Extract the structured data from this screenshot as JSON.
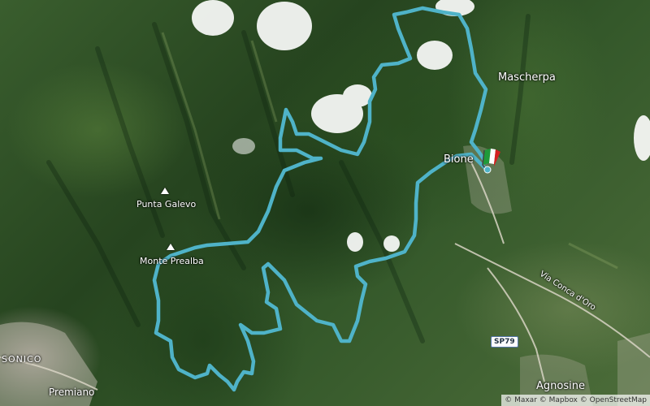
{
  "map": {
    "places": [
      {
        "name": "Mascherpa"
      },
      {
        "name": "Bione"
      },
      {
        "name": "Punta Galevo"
      },
      {
        "name": "Monte Prealba"
      },
      {
        "name": "SONICO"
      },
      {
        "name": "Premiano"
      },
      {
        "name": "Via Conca d'Oro"
      },
      {
        "name": "Agnosine"
      }
    ],
    "road_badge": "SP79",
    "attribution": "© Maxar © Mapbox © OpenStreetMap",
    "route_color": "#4fb3c8",
    "flag_colors": [
      "#1f9a3a",
      "#ffffff",
      "#d42020"
    ],
    "icons": [
      "peak-icon",
      "start-finish-flag-icon"
    ]
  }
}
